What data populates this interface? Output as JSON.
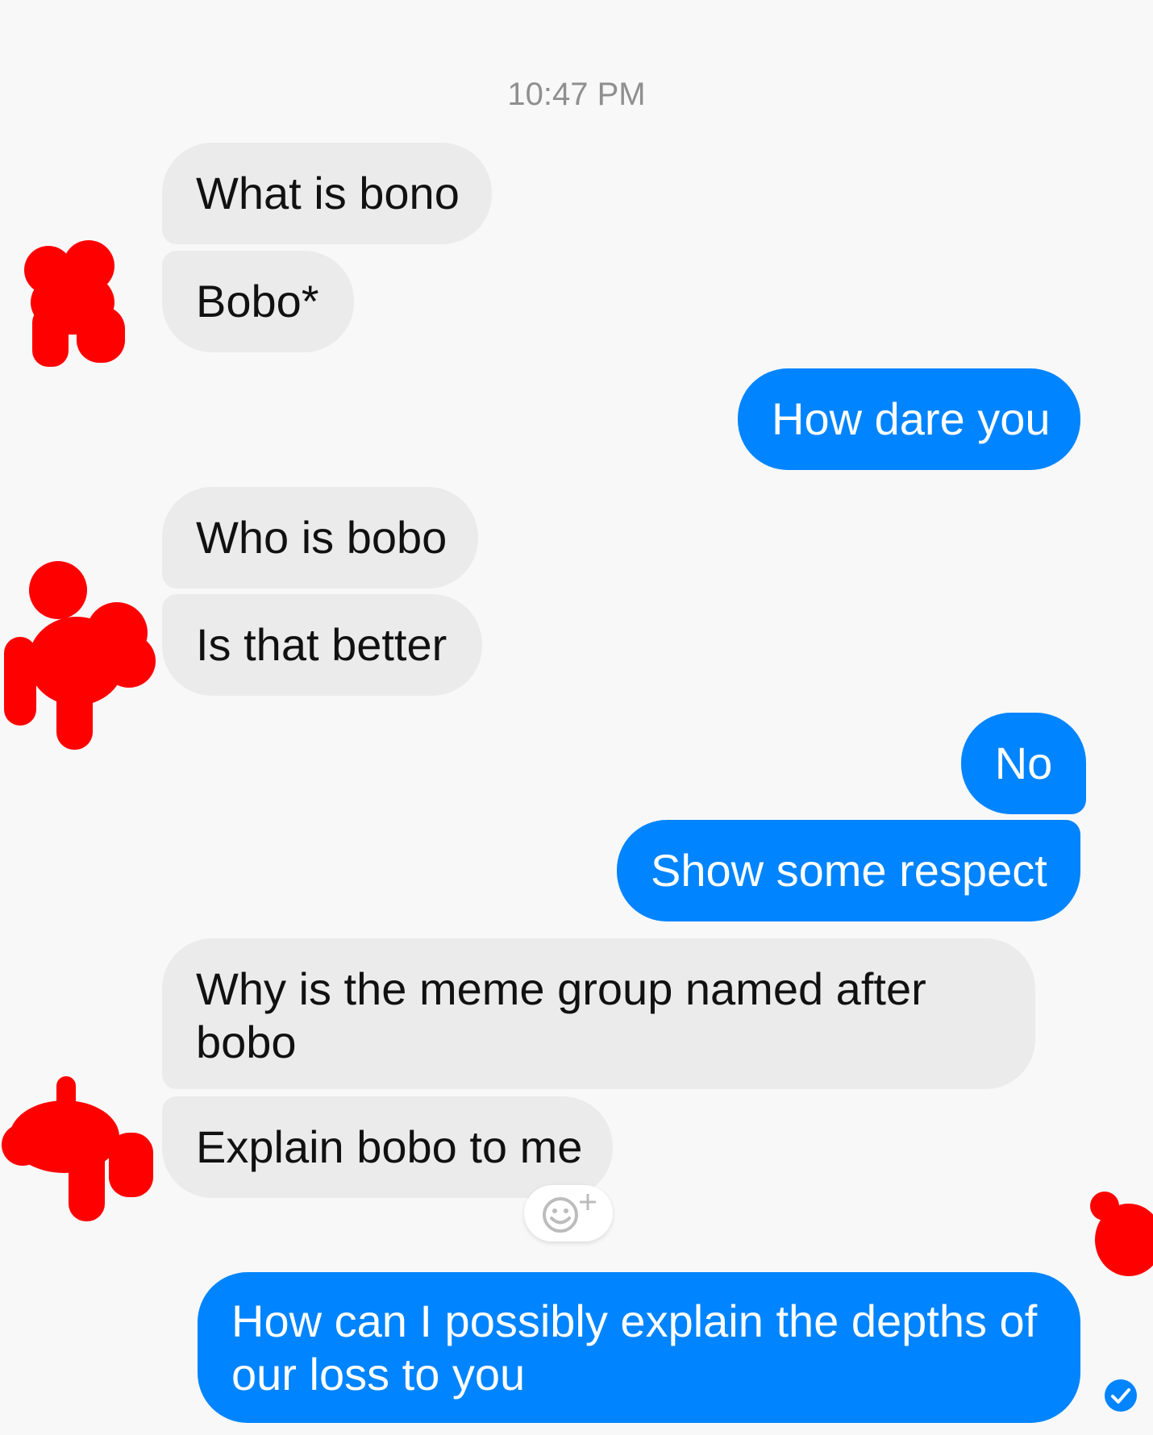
{
  "timestamp": "10:47 PM",
  "messages": [
    {
      "id": "m1",
      "sender": "other",
      "text": "What is bono"
    },
    {
      "id": "m2",
      "sender": "other",
      "text": "Bobo*"
    },
    {
      "id": "m3",
      "sender": "me",
      "text": "How dare you"
    },
    {
      "id": "m4",
      "sender": "other",
      "text": "Who is bobo"
    },
    {
      "id": "m5",
      "sender": "other",
      "text": "Is that better"
    },
    {
      "id": "m6",
      "sender": "me",
      "text": "No"
    },
    {
      "id": "m7",
      "sender": "me",
      "text": "Show some respect"
    },
    {
      "id": "m8",
      "sender": "other",
      "text": "Why is the meme group named after bobo"
    },
    {
      "id": "m9",
      "sender": "other",
      "text": "Explain bobo to me"
    },
    {
      "id": "m10",
      "sender": "me",
      "text": "How can I possibly explain the depths of our loss to you"
    }
  ],
  "colors": {
    "outgoing_bubble": "#0084ff",
    "incoming_bubble": "#ebebeb",
    "redaction": "#ff0000",
    "background": "#f8f8f8"
  },
  "icons": {
    "reaction": "add-reaction-icon",
    "read": "read-receipt-icon",
    "avatar": "redacted-avatar"
  }
}
